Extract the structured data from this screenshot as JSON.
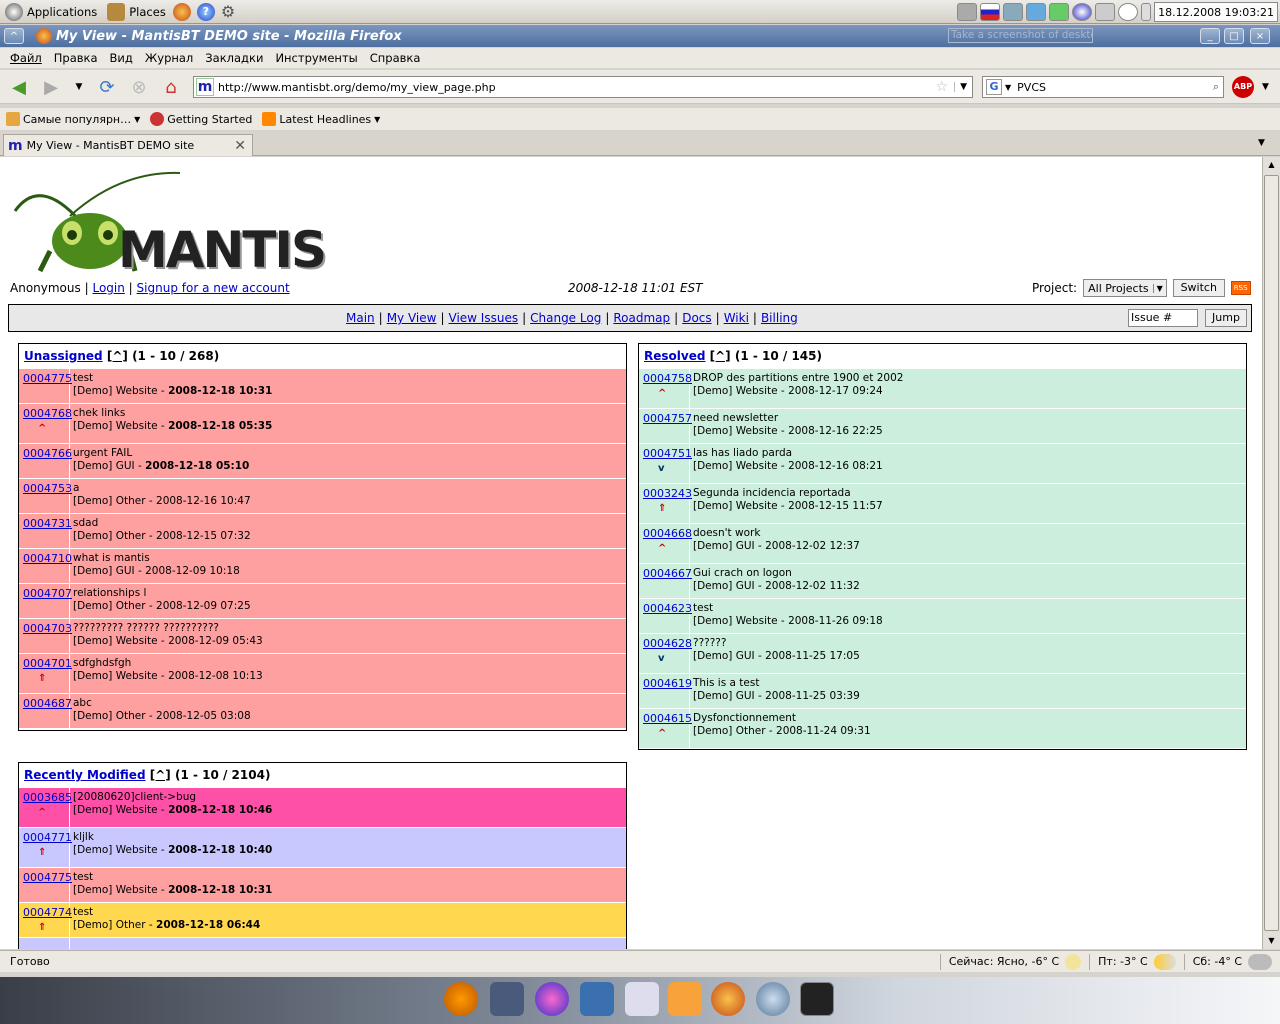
{
  "panel": {
    "applications": "Applications",
    "places": "Places",
    "clock": "18.12.2008 19:03:21"
  },
  "window": {
    "title": "My View - MantisBT DEMO site - Mozilla Firefox",
    "screenshot_hint": "Take a screenshot of desktop"
  },
  "menu": [
    "Файл",
    "Правка",
    "Вид",
    "Журнал",
    "Закладки",
    "Инструменты",
    "Справка"
  ],
  "nav": {
    "url": "http://www.mantisbt.org/demo/my_view_page.php",
    "search_value": "PVCS"
  },
  "bookmarks": [
    {
      "label": "Самые популярн…",
      "icon": "folder-icon"
    },
    {
      "label": "Getting Started",
      "icon": "firefox-icon"
    },
    {
      "label": "Latest Headlines",
      "icon": "rss-icon"
    }
  ],
  "tab": {
    "label": "My View - MantisBT DEMO site"
  },
  "page": {
    "logo_text": "MANTIS",
    "user": "Anonymous",
    "sep": "|",
    "login": "Login",
    "signup": "Signup for a new account",
    "datetime": "2008-12-18 11:01 EST",
    "project_label": "Project:",
    "project_value": "All Projects",
    "switch": "Switch",
    "rss": "RSS",
    "menu_links": [
      "Main",
      "My View",
      "View Issues",
      "Change Log",
      "Roadmap",
      "Docs",
      "Wiki",
      "Billing"
    ],
    "issue_placeholder": "Issue #",
    "jump": "Jump"
  },
  "boxes": {
    "unassigned": {
      "title": "Unassigned",
      "caret": "[^]",
      "count": "(1 - 10 / 268)",
      "color": "#ffa0a0",
      "rows": [
        {
          "id": "0004775",
          "summary": "test",
          "meta": "[Demo] Website - ",
          "date": "2008-12-18 10:31",
          "bold": true,
          "pri": ""
        },
        {
          "id": "0004768",
          "summary": "chek links",
          "meta": "[Demo] Website - ",
          "date": "2008-12-18 05:35",
          "bold": true,
          "pri": "^"
        },
        {
          "id": "0004766",
          "summary": "urgent FAIL",
          "meta": "[Demo] GUI - ",
          "date": "2008-12-18 05:10",
          "bold": true,
          "pri": ""
        },
        {
          "id": "0004753",
          "summary": "a",
          "meta": "[Demo] Other - ",
          "date": "2008-12-16 10:47",
          "bold": false,
          "pri": ""
        },
        {
          "id": "0004731",
          "summary": "sdad",
          "meta": "[Demo] Other - ",
          "date": "2008-12-15 07:32",
          "bold": false,
          "pri": ""
        },
        {
          "id": "0004710",
          "summary": "what is mantis",
          "meta": "[Demo] GUI - ",
          "date": "2008-12-09 10:18",
          "bold": false,
          "pri": ""
        },
        {
          "id": "0004707",
          "summary": "relationships l",
          "meta": "[Demo] Other - ",
          "date": "2008-12-09 07:25",
          "bold": false,
          "pri": ""
        },
        {
          "id": "0004703",
          "summary": "????????? ?????? ??????????",
          "meta": "[Demo] Website - ",
          "date": "2008-12-09 05:43",
          "bold": false,
          "pri": ""
        },
        {
          "id": "0004701",
          "summary": "sdfghdsfgh",
          "meta": "[Demo] Website - ",
          "date": "2008-12-08 10:13",
          "bold": false,
          "pri": "⇑"
        },
        {
          "id": "0004687",
          "summary": "abc",
          "meta": "[Demo] Other - ",
          "date": "2008-12-05 03:08",
          "bold": false,
          "pri": ""
        }
      ]
    },
    "resolved": {
      "title": "Resolved",
      "caret": "[^]",
      "count": "(1 - 10 / 145)",
      "color": "#cceedd",
      "rows": [
        {
          "id": "0004758",
          "summary": "DROP des partitions entre 1900 et 2002",
          "meta": "[Demo] Website - ",
          "date": "2008-12-17 09:24",
          "bold": false,
          "pri": "^"
        },
        {
          "id": "0004757",
          "summary": "need newsletter",
          "meta": "[Demo] Website - ",
          "date": "2008-12-16 22:25",
          "bold": false,
          "pri": ""
        },
        {
          "id": "0004751",
          "summary": "las has liado parda",
          "meta": "[Demo] Website - ",
          "date": "2008-12-16 08:21",
          "bold": false,
          "pri": "v"
        },
        {
          "id": "0003243",
          "summary": "Segunda incidencia reportada",
          "meta": "[Demo] Website - ",
          "date": "2008-12-15 11:57",
          "bold": false,
          "pri": "⇑"
        },
        {
          "id": "0004668",
          "summary": "doesn't work",
          "meta": "[Demo] GUI - ",
          "date": "2008-12-02 12:37",
          "bold": false,
          "pri": "^"
        },
        {
          "id": "0004667",
          "summary": "Gui crach on logon",
          "meta": "[Demo] GUI - ",
          "date": "2008-12-02 11:32",
          "bold": false,
          "pri": ""
        },
        {
          "id": "0004623",
          "summary": "test",
          "meta": "[Demo] Website - ",
          "date": "2008-11-26 09:18",
          "bold": false,
          "pri": ""
        },
        {
          "id": "0004628",
          "summary": "??????",
          "meta": "[Demo] GUI - ",
          "date": "2008-11-25 17:05",
          "bold": false,
          "pri": "v"
        },
        {
          "id": "0004619",
          "summary": "This is a test",
          "meta": "[Demo] GUI - ",
          "date": "2008-11-25 03:39",
          "bold": false,
          "pri": ""
        },
        {
          "id": "0004615",
          "summary": "Dysfonctionnement",
          "meta": "[Demo] Other - ",
          "date": "2008-11-24 09:31",
          "bold": false,
          "pri": "^"
        }
      ]
    },
    "recent": {
      "title": "Recently Modified",
      "caret": "[^]",
      "count": "(1 - 10 / 2104)",
      "rows": [
        {
          "id": "0003685",
          "summary": "[20080620]client->bug",
          "meta": "[Demo] Website - ",
          "date": "2008-12-18 10:46",
          "bold": true,
          "pri": "^",
          "color": "#ff50a8"
        },
        {
          "id": "0004771",
          "summary": "kljlk",
          "meta": "[Demo] Website - ",
          "date": "2008-12-18 10:40",
          "bold": true,
          "pri": "⇑",
          "color": "#c8c8ff"
        },
        {
          "id": "0004775",
          "summary": "test",
          "meta": "[Demo] Website - ",
          "date": "2008-12-18 10:31",
          "bold": true,
          "pri": "",
          "color": "#ffa0a0"
        },
        {
          "id": "0004774",
          "summary": "test",
          "meta": "[Demo] Other - ",
          "date": "2008-12-18 06:44",
          "bold": true,
          "pri": "⇑",
          "color": "#ffd850"
        },
        {
          "id": "",
          "summary": "",
          "meta": "",
          "date": "",
          "bold": false,
          "pri": "",
          "color": "#c8c8ff"
        }
      ]
    }
  },
  "statusbar": {
    "left": "Готово",
    "w1": "Сейчас: Ясно, -6° C",
    "w2": "Пт: -3° C",
    "w3": "Сб: -4° C"
  }
}
